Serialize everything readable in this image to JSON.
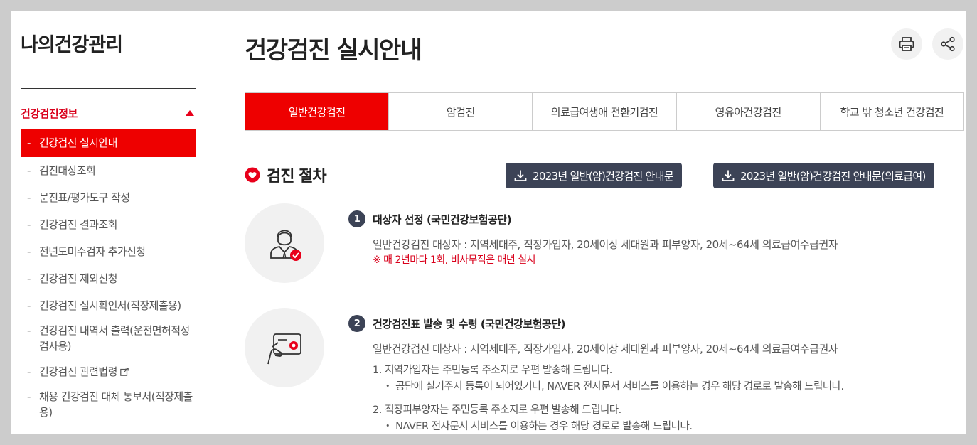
{
  "sidebar": {
    "title": "나의건강관리",
    "section": "건강검진정보",
    "items": [
      {
        "label": "건강검진 실시안내"
      },
      {
        "label": "검진대상조회"
      },
      {
        "label": "문진표/평가도구 작성"
      },
      {
        "label": "건강검진 결과조회"
      },
      {
        "label": "전년도미수검자 추가신청"
      },
      {
        "label": "건강검진 제외신청"
      },
      {
        "label": "건강검진 실시확인서(직장제출용)"
      },
      {
        "label": "건강검진 내역서 출력(운전면허적성검사용)"
      },
      {
        "label": "건강검진 관련법령"
      },
      {
        "label": "채용 건강검진 대체 통보서(직장제출용)"
      }
    ]
  },
  "main": {
    "title": "건강검진 실시안내",
    "tabs": [
      {
        "label": "일반건강검진"
      },
      {
        "label": "암검진"
      },
      {
        "label": "의료급여생애 전환기검진"
      },
      {
        "label": "영유아건강검진"
      },
      {
        "label": "학교 밖 청소년 건강검진"
      }
    ],
    "section_title": "검진 절차",
    "download_1": "2023년 일반(암)건강검진 안내문",
    "download_2": "2023년 일반(암)건강검진 안내문(의료급여)",
    "steps": [
      {
        "num": "1",
        "title": "대상자 선정 (국민건강보험공단)",
        "desc": "일반건강검진 대상자 : 지역세대주, 직장가입자, 20세이상 세대원과 피부양자, 20세~64세 의료급여수급권자",
        "note": "※ 매 2년마다 1회, 비사무직은 매년 실시"
      },
      {
        "num": "2",
        "title": "건강검진표 발송 및 수령 (국민건강보험공단)",
        "desc": "일반건강검진 대상자 : 지역세대주, 직장가입자, 20세이상 세대원과 피부양자, 20세~64세 의료급여수급권자",
        "sub1": "1. 지역가입자는 주민등록 주소지로 우편 발송해 드립니다.",
        "sub1_bullet": "・ 공단에 실거주지 등록이 되어있거나, NAVER 전자문서 서비스를 이용하는 경우 해당 경로로 발송해 드립니다.",
        "sub2": "2. 직장피부양자는 주민등록 주소지로 우편 발송해 드립니다.",
        "sub2_bullet": "・ NAVER 전자문서 서비스를 이용하는 경우 해당 경로로 발송해 드립니다."
      }
    ]
  },
  "colors": {
    "accent": "#ee0000",
    "dark_button": "#3c4356",
    "note_red": "#d9001b"
  }
}
